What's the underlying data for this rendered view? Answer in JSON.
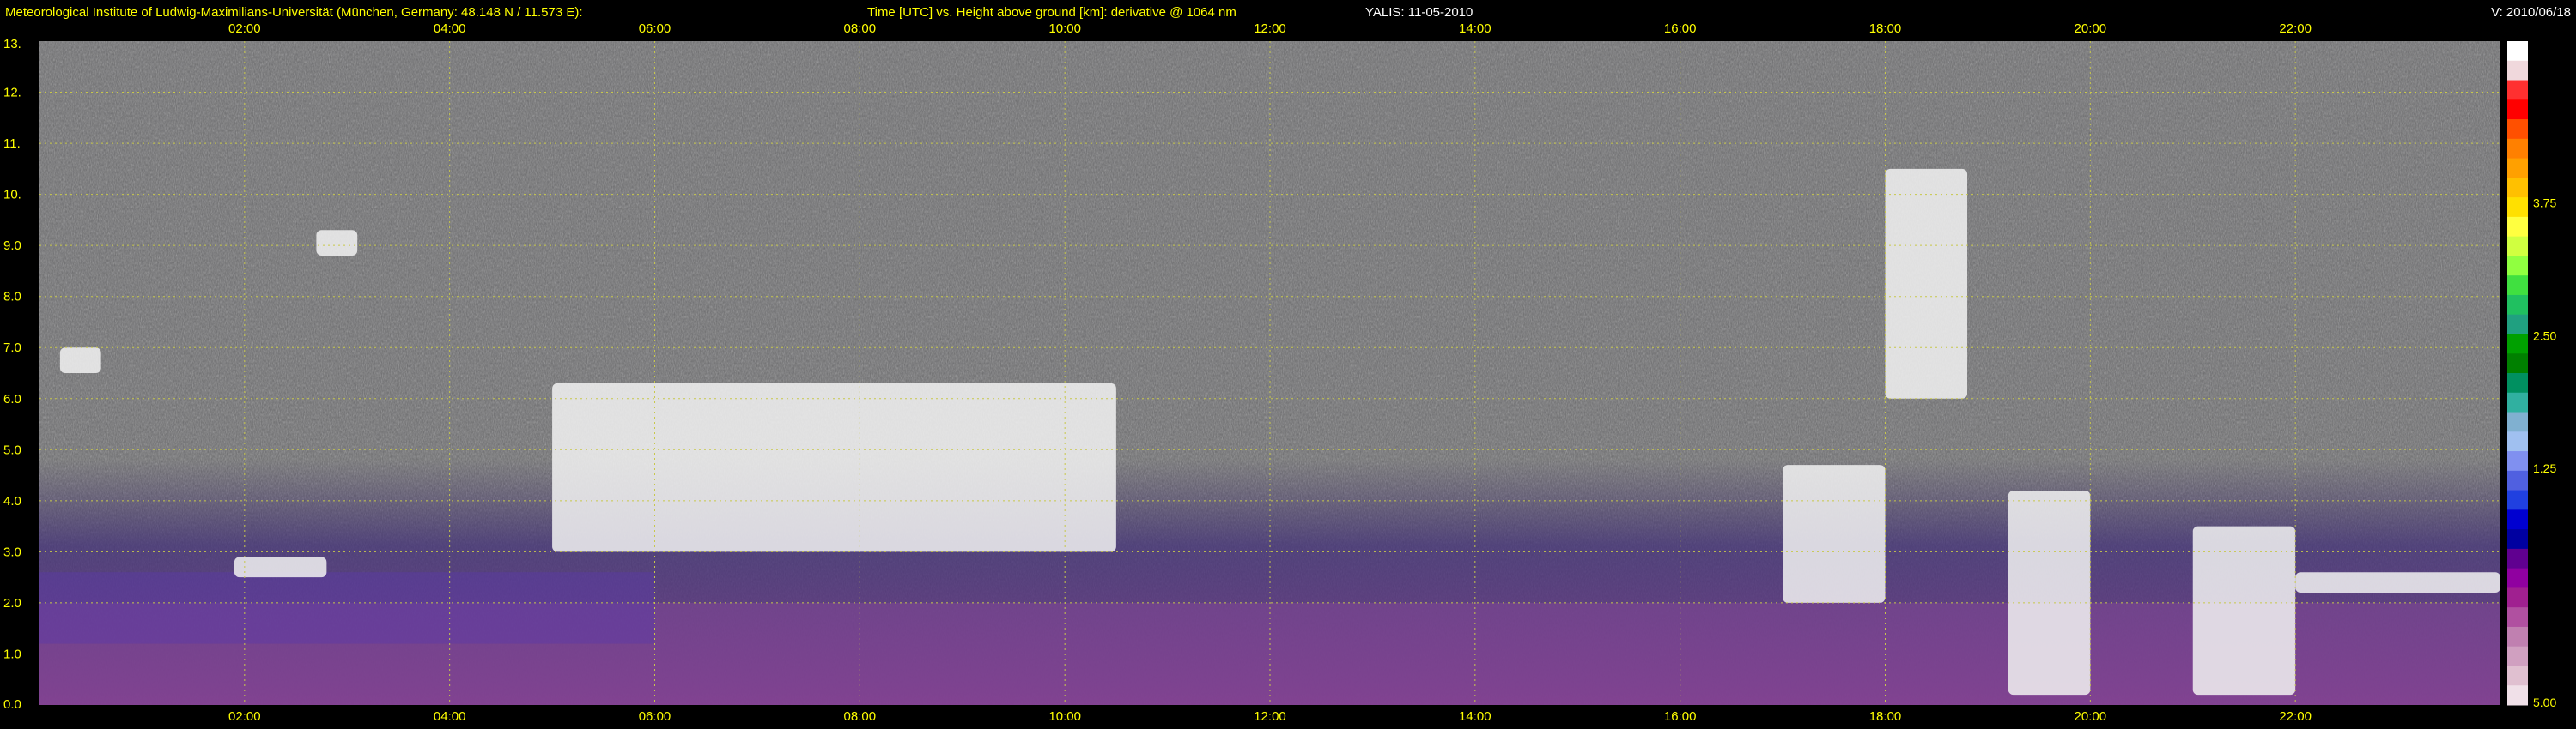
{
  "header": {
    "institute": "Meteorological Institute of Ludwig-Maximilians-Universität (München, Germany: 48.148 N / 11.573 E):",
    "axes_description": "Time [UTC] vs. Height above ground [km]: derivative @ 1064 nm",
    "instrument": "YALIS: 11-05-2010",
    "version": "V: 2010/06/18"
  },
  "colors": {
    "text": "#ffff00",
    "grid": "#c8c84a",
    "background": "#000000",
    "plot_bg": "#6a6a6c"
  },
  "chart_data": {
    "type": "heatmap",
    "title": "Time [UTC] vs. Height above ground [km]: derivative @ 1064 nm",
    "xlabel": "Time [UTC]",
    "ylabel": "Height above ground [km]",
    "x_unit": "hours UTC",
    "xlim": [
      0,
      24
    ],
    "ylim": [
      0,
      13
    ],
    "x_ticks": [
      {
        "value": 2,
        "label": "02:00"
      },
      {
        "value": 4,
        "label": "04:00"
      },
      {
        "value": 6,
        "label": "06:00"
      },
      {
        "value": 8,
        "label": "08:00"
      },
      {
        "value": 10,
        "label": "10:00"
      },
      {
        "value": 12,
        "label": "12:00"
      },
      {
        "value": 14,
        "label": "14:00"
      },
      {
        "value": 16,
        "label": "16:00"
      },
      {
        "value": 18,
        "label": "18:00"
      },
      {
        "value": 20,
        "label": "20:00"
      },
      {
        "value": 22,
        "label": "22:00"
      }
    ],
    "y_ticks": [
      {
        "value": 0,
        "label": "0.0"
      },
      {
        "value": 1,
        "label": "1.0"
      },
      {
        "value": 2,
        "label": "2.0"
      },
      {
        "value": 3,
        "label": "3.0"
      },
      {
        "value": 4,
        "label": "4.0"
      },
      {
        "value": 5,
        "label": "5.0"
      },
      {
        "value": 6,
        "label": "6.0"
      },
      {
        "value": 7,
        "label": "7.0"
      },
      {
        "value": 8,
        "label": "8.0"
      },
      {
        "value": 9,
        "label": "9.0"
      },
      {
        "value": 10,
        "label": "10."
      },
      {
        "value": 11,
        "label": "11."
      },
      {
        "value": 12,
        "label": "12."
      },
      {
        "value": 13,
        "label": "13."
      }
    ],
    "grid": true,
    "colorbar": {
      "placement": "right",
      "range": [
        5.0,
        0
      ],
      "ticks": [
        {
          "value": 3.75,
          "label": "3.75"
        },
        {
          "value": 2.5,
          "label": "2.50"
        },
        {
          "value": 1.25,
          "label": "1.25"
        },
        {
          "value": 5.0,
          "label": "5.00"
        }
      ],
      "colors": [
        "#ffffff",
        "#f0d8dc",
        "#ff3030",
        "#ff0000",
        "#ff5000",
        "#ff8000",
        "#ffa000",
        "#ffc000",
        "#ffe000",
        "#ffff40",
        "#d0ff40",
        "#90ff40",
        "#40e040",
        "#20c060",
        "#20a080",
        "#00a000",
        "#008000",
        "#009060",
        "#30b0a0",
        "#80b0d0",
        "#a0c0f0",
        "#8090f0",
        "#5060e0",
        "#2040e0",
        "#0000d0",
        "#0000a0",
        "#600090",
        "#9000a0",
        "#a02090",
        "#b050a0",
        "#c080b0",
        "#d0a0c0",
        "#e0c0d0",
        "#f0e0e8"
      ]
    },
    "features": [
      {
        "name": "boundary layer aerosol",
        "t_start": 0,
        "t_end": 24,
        "h_bottom": 0.0,
        "h_top": 2.0
      },
      {
        "name": "aerosol layer",
        "t_start": 0.0,
        "t_end": 6.0,
        "h_bottom": 1.2,
        "h_top": 2.6
      },
      {
        "name": "cloud",
        "t_start": 1.9,
        "t_end": 2.8,
        "h_bottom": 2.5,
        "h_top": 2.9
      },
      {
        "name": "cloud",
        "t_start": 0.2,
        "t_end": 0.6,
        "h_bottom": 6.5,
        "h_top": 7.0
      },
      {
        "name": "cloud",
        "t_start": 2.7,
        "t_end": 3.1,
        "h_bottom": 8.8,
        "h_top": 9.3
      },
      {
        "name": "cloud band",
        "t_start": 5.0,
        "t_end": 10.5,
        "h_bottom": 3.0,
        "h_top": 6.3
      },
      {
        "name": "cloud",
        "t_start": 17.0,
        "t_end": 18.0,
        "h_bottom": 2.0,
        "h_top": 4.7
      },
      {
        "name": "cloud",
        "t_start": 18.0,
        "t_end": 18.8,
        "h_bottom": 6.0,
        "h_top": 10.5
      },
      {
        "name": "cloud",
        "t_start": 19.2,
        "t_end": 20.0,
        "h_bottom": 0.2,
        "h_top": 4.2
      },
      {
        "name": "cloud",
        "t_start": 21.0,
        "t_end": 22.0,
        "h_bottom": 0.2,
        "h_top": 3.5
      },
      {
        "name": "cloud",
        "t_start": 22.0,
        "t_end": 24.0,
        "h_bottom": 2.2,
        "h_top": 2.6
      }
    ]
  }
}
